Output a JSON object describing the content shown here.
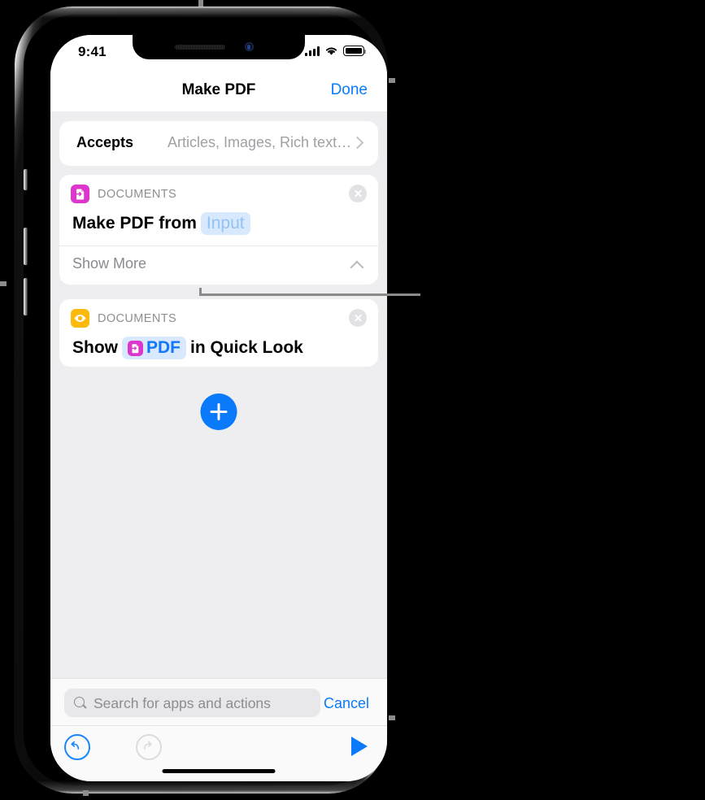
{
  "status_bar": {
    "time": "9:41",
    "signal_icon": "cellular-bars-icon",
    "wifi_icon": "wifi-icon",
    "battery_icon": "battery-full-icon"
  },
  "nav_bar": {
    "title": "Make PDF",
    "done_label": "Done"
  },
  "accepts_row": {
    "label": "Accepts",
    "value": "Articles, Images, Rich text…",
    "chevron_icon": "chevron-right-icon"
  },
  "actions": [
    {
      "category": "DOCUMENTS",
      "icon": "make-pdf-document-icon",
      "icon_color": "#dd36cd",
      "text_before": "Make PDF from",
      "token": "Input",
      "text_after": "",
      "show_more_label": "Show More",
      "show_more_chevron": "chevron-up-icon",
      "close_icon": "close-circle-icon"
    },
    {
      "category": "DOCUMENTS",
      "icon": "quick-look-eye-icon",
      "icon_color": "#fcbb0c",
      "text_before": "Show",
      "token": "PDF",
      "token_icon": "pdf-document-icon",
      "text_after": "in Quick Look",
      "close_icon": "close-circle-icon"
    }
  ],
  "add_button": {
    "icon": "plus-icon",
    "color": "#0a7afb"
  },
  "search": {
    "placeholder": "Search for apps and actions",
    "icon": "search-icon",
    "cancel_label": "Cancel"
  },
  "toolbar": {
    "undo_icon": "undo-icon",
    "redo_icon": "redo-icon",
    "run_icon": "play-icon",
    "accent_color": "#0a7afb",
    "disabled_color": "#dcdcdf"
  }
}
